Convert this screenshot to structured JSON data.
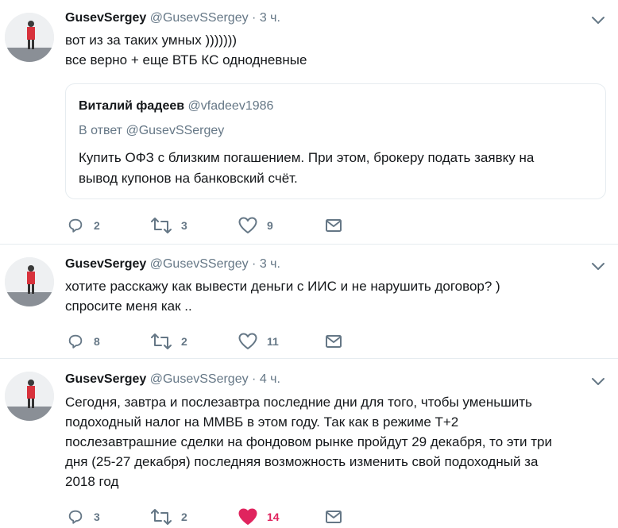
{
  "tweets": [
    {
      "name": "GusevSergey",
      "handle": "@GusevSSergey",
      "time": "3 ч.",
      "lines": [
        "вот из за таких умных )))))))",
        "все верно + еще ВТБ КС однодневные"
      ],
      "quote": {
        "name": "Виталий фадеев",
        "handle": "@vfadeev1986",
        "reply_to": "В ответ @GusevSSergey",
        "lines": [
          "Купить ОФЗ с близким  погашением. При этом, брокеру подать заявку на",
          "вывод купонов на банковский счёт."
        ]
      },
      "replies": "2",
      "retweets": "3",
      "likes": "9",
      "liked": false
    },
    {
      "name": "GusevSergey",
      "handle": "@GusevSSergey",
      "time": "3 ч.",
      "lines": [
        "хотите расскажу как вывести деньги с ИИС и не нарушить договор? )",
        "спросите меня как .."
      ],
      "replies": "8",
      "retweets": "2",
      "likes": "11",
      "liked": false
    },
    {
      "name": "GusevSergey",
      "handle": "@GusevSSergey",
      "time": "4 ч.",
      "lines": [
        "Сегодня, завтра и послезавтра последние дни для того, чтобы уменьшить",
        "подоходный налог на ММВБ в этом году. Так как в режиме Т+2",
        "послезавтрашние сделки на фондовом рынке пройдут 29 декабря, то эти три",
        "дня (25-27 декабря) последняя возможность изменить свой подоходный за",
        "2018 год"
      ],
      "replies": "3",
      "retweets": "2",
      "likes": "14",
      "liked": true
    }
  ],
  "colors": {
    "icon": "#657786",
    "like_active": "#e0245e",
    "divider": "#e6ecf0"
  },
  "icons": [
    "reply-icon",
    "retweet-icon",
    "like-icon",
    "message-icon",
    "chevron-down-icon"
  ]
}
